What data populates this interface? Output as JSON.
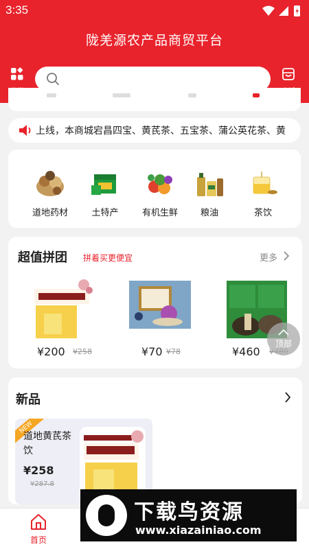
{
  "status_bar": {
    "time": "3:35"
  },
  "header": {
    "title": "陇羌源农产品商贸平台",
    "category_label": "分类",
    "store_label": "店铺",
    "search_placeholder": ""
  },
  "notice": {
    "text": "上线，本商城宕昌四宝、黄芪茶、五宝茶、蒲公英花茶、黄"
  },
  "categories": [
    {
      "label": "道地药材",
      "icon": "herbs-thumb"
    },
    {
      "label": "土特产",
      "icon": "local-specialty-thumb"
    },
    {
      "label": "有机生鲜",
      "icon": "fresh-produce-thumb"
    },
    {
      "label": "粮油",
      "icon": "grain-oil-thumb"
    },
    {
      "label": "茶饮",
      "icon": "tea-thumb"
    }
  ],
  "group_buy": {
    "title": "超值拼团",
    "subtitle": "拼着买更便宜",
    "more_label": "更多",
    "items": [
      {
        "price": "¥200",
        "original": "¥258"
      },
      {
        "price": "¥70",
        "original": "¥78"
      },
      {
        "price": "¥460",
        "original": "¥480"
      }
    ]
  },
  "back_to_top": {
    "label": "顶部"
  },
  "new_products": {
    "title": "新品",
    "badge": "NEW",
    "items": [
      {
        "name": "道地黄芪茶饮",
        "price": "¥258",
        "original": "¥287.8"
      }
    ]
  },
  "tabbar": {
    "tabs": [
      {
        "label": "首页"
      }
    ]
  },
  "watermark": {
    "title": "下载鸟资源",
    "url": "www.xiazainiao.com"
  },
  "colors": {
    "brand_red": "#e8232c",
    "page_bg": "#f2f2f2"
  }
}
